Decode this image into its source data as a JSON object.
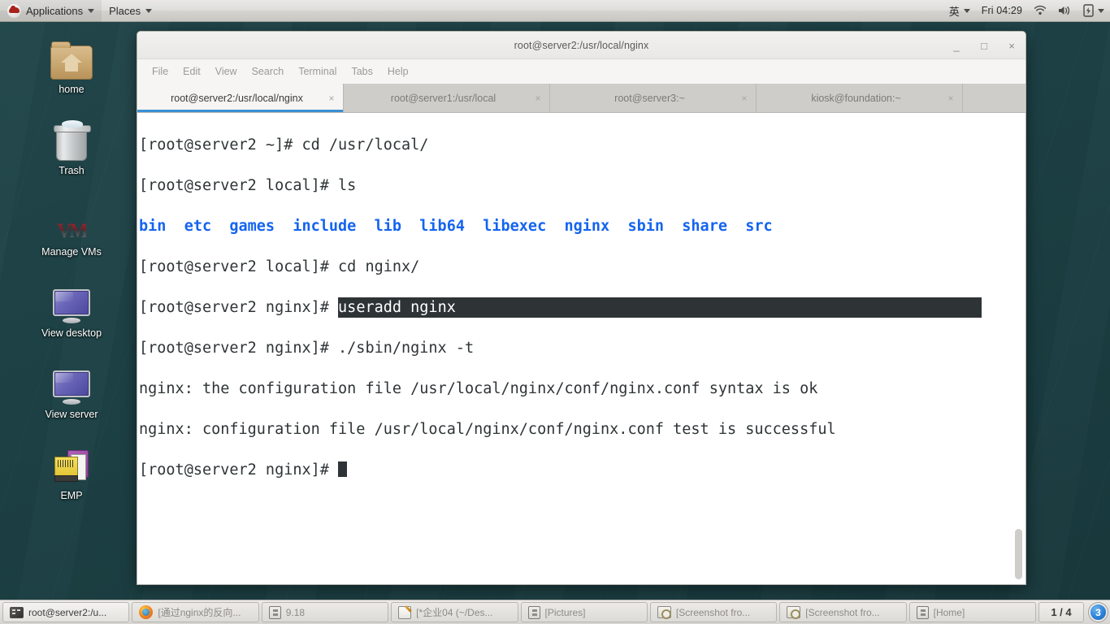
{
  "top_panel": {
    "logo_icon": "redhat-logo-icon",
    "applications_label": "Applications",
    "places_label": "Places",
    "input_method": "英",
    "clock": "Fri 04:29",
    "wifi_icon": "wifi-icon",
    "volume_icon": "volume-icon",
    "power_icon": "battery-icon"
  },
  "desktop_icons": [
    {
      "label": "home",
      "icon": "home-folder-icon"
    },
    {
      "label": "Trash",
      "icon": "trash-icon"
    },
    {
      "label": "Manage VMs",
      "icon": "vmware-icon"
    },
    {
      "label": "View desktop",
      "icon": "monitor-icon"
    },
    {
      "label": "View server",
      "icon": "monitor-icon"
    },
    {
      "label": "EMP",
      "icon": "emp-card-icon"
    }
  ],
  "terminal": {
    "title": "root@server2:/usr/local/nginx",
    "window_buttons": {
      "minimize": "_",
      "maximize": "□",
      "close": "×"
    },
    "menu": [
      "File",
      "Edit",
      "View",
      "Search",
      "Terminal",
      "Tabs",
      "Help"
    ],
    "tabs": [
      {
        "label": "root@server2:/usr/local/nginx",
        "active": true,
        "close": "×"
      },
      {
        "label": "root@server1:/usr/local",
        "active": false,
        "close": "×"
      },
      {
        "label": "root@server3:~",
        "active": false,
        "close": "×"
      },
      {
        "label": "kiosk@foundation:~",
        "active": false,
        "close": "×"
      }
    ],
    "accent_color": "#3a8fd4",
    "dir_color": "#1464f0",
    "selection_bg": "#2e3436",
    "lines": {
      "l1": "[root@server2 ~]# cd /usr/local/",
      "l2": "[root@server2 local]# ls",
      "l3_dirs": "bin  etc  games  include  lib  lib64  libexec  nginx  sbin  share  src",
      "l4": "[root@server2 local]# cd nginx/",
      "l5_prompt": "[root@server2 nginx]# ",
      "l5_selected": "useradd nginx",
      "l6": "[root@server2 nginx]# ./sbin/nginx -t",
      "l7": "nginx: the configuration file /usr/local/nginx/conf/nginx.conf syntax is ok",
      "l8": "nginx: configuration file /usr/local/nginx/conf/nginx.conf test is successful",
      "l9_prompt": "[root@server2 nginx]# "
    }
  },
  "taskbar": {
    "items": [
      {
        "label": "root@server2:/u...",
        "icon": "terminal-icon",
        "active": true
      },
      {
        "label": "[通过nginx的反向...",
        "icon": "firefox-icon",
        "active": false
      },
      {
        "label": "9.18",
        "icon": "archive-icon",
        "active": false
      },
      {
        "label": "[*企业04 (~/Des...",
        "icon": "text-editor-icon",
        "active": false
      },
      {
        "label": "[Pictures]",
        "icon": "archive-icon",
        "active": false
      },
      {
        "label": "[Screenshot fro...",
        "icon": "screenshot-icon",
        "active": false
      },
      {
        "label": "[Screenshot fro...",
        "icon": "screenshot-icon",
        "active": false
      },
      {
        "label": "[Home]",
        "icon": "archive-icon",
        "active": false
      }
    ],
    "workspace": "1 / 4",
    "notification_count": "3"
  }
}
